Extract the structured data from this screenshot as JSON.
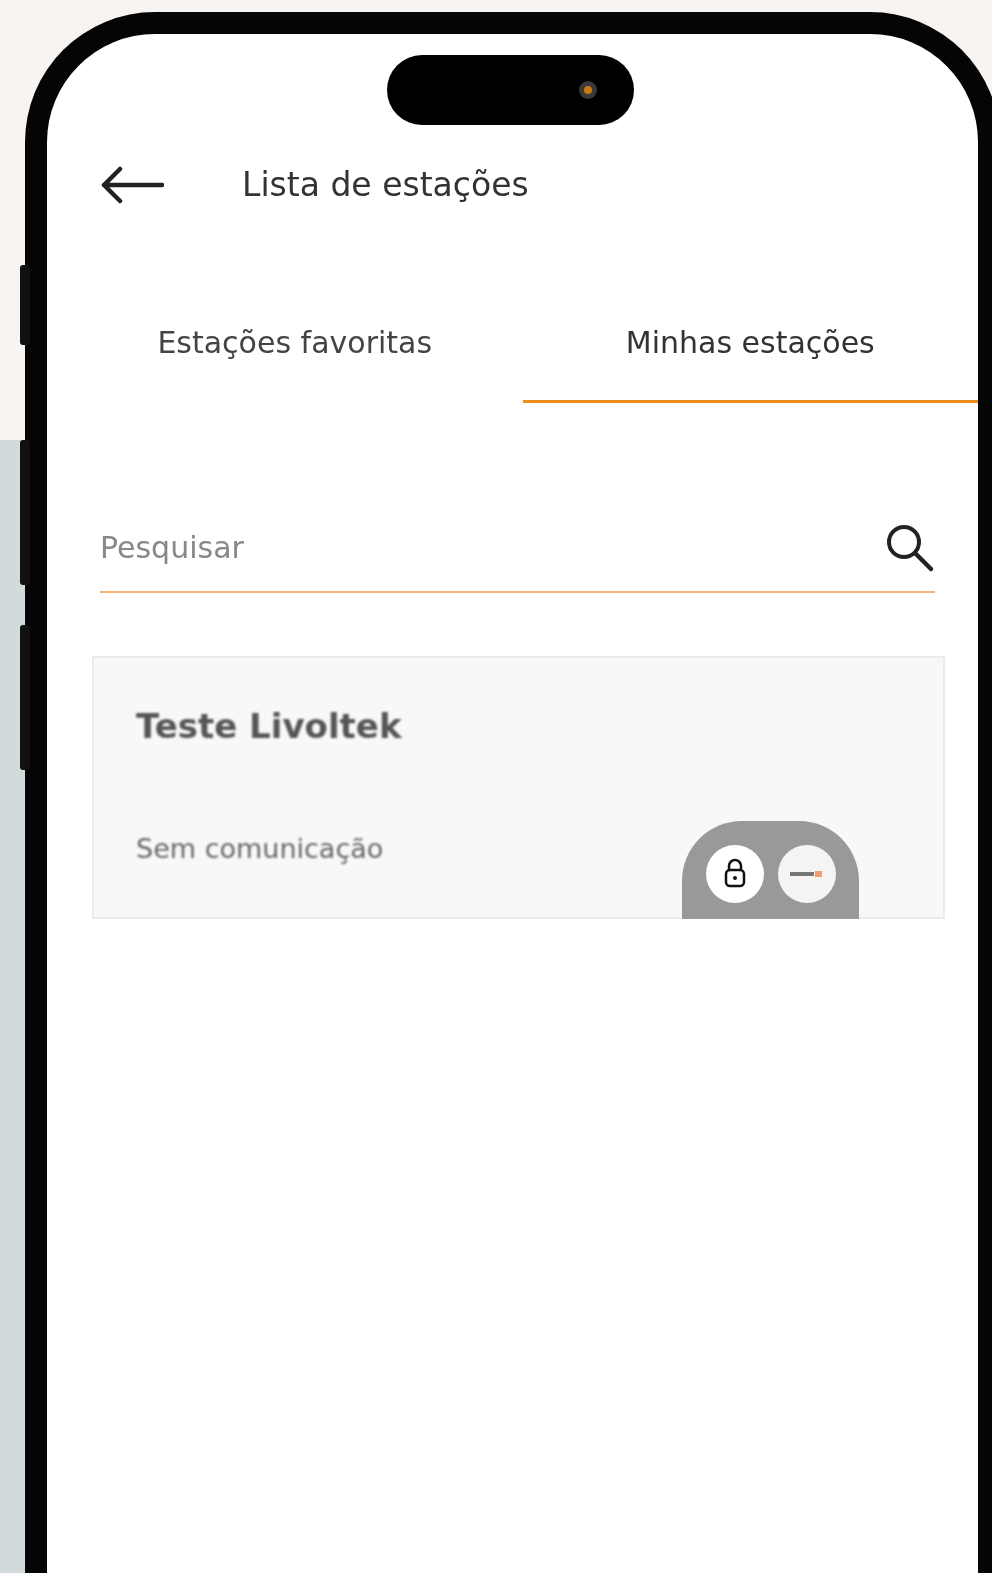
{
  "header": {
    "title": "Lista de estações"
  },
  "tabs": [
    {
      "label": "Estações favoritas",
      "selected": false
    },
    {
      "label": "Minhas estações",
      "selected": true
    }
  ],
  "search": {
    "placeholder": "Pesquisar"
  },
  "stations": [
    {
      "name": "Teste Livoltek",
      "status": "Sem comunicação"
    }
  ]
}
